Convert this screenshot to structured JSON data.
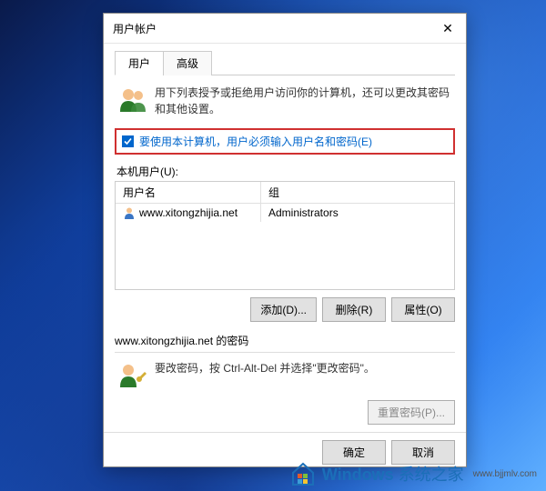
{
  "dialog": {
    "title": "用户帐户",
    "close_x": "✕",
    "tabs": {
      "users": "用户",
      "advanced": "高级"
    },
    "description": "用下列表授予或拒绝用户访问你的计算机，还可以更改其密码和其他设置。",
    "checkbox_label": "要使用本计算机，用户必须输入用户名和密码(E)",
    "checkbox_checked": true,
    "users_section_label": "本机用户(U):",
    "table": {
      "col_user": "用户名",
      "col_group": "组",
      "rows": [
        {
          "username": "www.xitongzhijia.net",
          "group": "Administrators"
        }
      ]
    },
    "buttons": {
      "add": "添加(D)...",
      "remove": "删除(R)",
      "props": "属性(O)"
    },
    "password_section_label": "www.xitongzhijia.net 的密码",
    "password_hint": "要改密码，按 Ctrl-Alt-Del 并选择\"更改密码\"。",
    "reset_pw": "重置密码(P)..."
  },
  "footer": {
    "ok": "确定",
    "cancel": "取消"
  },
  "logo": {
    "brand": "Windows",
    "brand_suffix": "系统之家",
    "url": "www.bjjmlv.com"
  }
}
